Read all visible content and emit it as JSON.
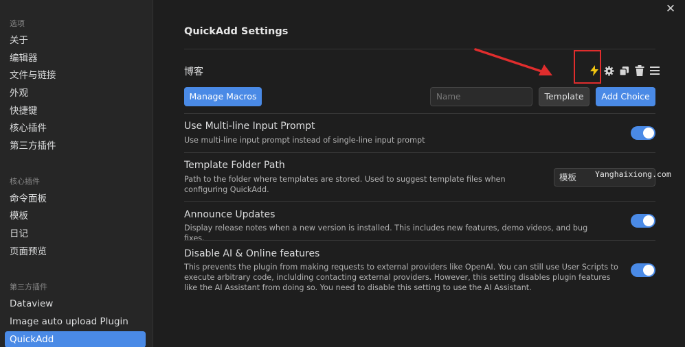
{
  "sidebar": {
    "section_options": "选项",
    "options_items": [
      "关于",
      "编辑器",
      "文件与链接",
      "外观",
      "快捷键",
      "核心插件",
      "第三方插件"
    ],
    "section_core": "核心插件",
    "core_items": [
      "命令面板",
      "模板",
      "日记",
      "页面预览"
    ],
    "section_community": "第三方插件",
    "community_items": [
      "Dataview",
      "Image auto upload Plugin",
      "QuickAdd"
    ],
    "active": "QuickAdd"
  },
  "close_icon": "close-icon",
  "page": {
    "title": "QuickAdd Settings",
    "choice": {
      "name": "博客",
      "icons": [
        "lightning-icon",
        "gear-icon",
        "duplicate-icon",
        "trash-icon",
        "drag-handle-icon"
      ]
    },
    "manage_macros_label": "Manage Macros",
    "name_placeholder": "Name",
    "template_label": "Template",
    "add_choice_label": "Add Choice",
    "settings": [
      {
        "name": "Use Multi-line Input Prompt",
        "desc": "Use multi-line input prompt instead of single-line input prompt",
        "enabled": true
      },
      {
        "name": "Template Folder Path",
        "desc": "Path to the folder where templates are stored. Used to suggest template files when configuring QuickAdd.",
        "value": "模板"
      },
      {
        "name": "Announce Updates",
        "desc": "Display release notes when a new version is installed. This includes new features, demo videos, and bug fixes.",
        "enabled": true
      },
      {
        "name": "Disable AI & Online features",
        "desc": "This prevents the plugin from making requests to external providers like OpenAI. You can still use User Scripts to execute arbitrary code, inclulding contacting external providers. However, this setting disables plugin features like the AI Assistant from doing so. You need to disable this setting to use the AI Assistant.",
        "enabled": true
      }
    ],
    "watermark": "Yanghaixiong.com"
  },
  "colors": {
    "accent": "#4a8ae6",
    "annotation_red": "#e02d2d",
    "lightning": "#f2c511"
  }
}
